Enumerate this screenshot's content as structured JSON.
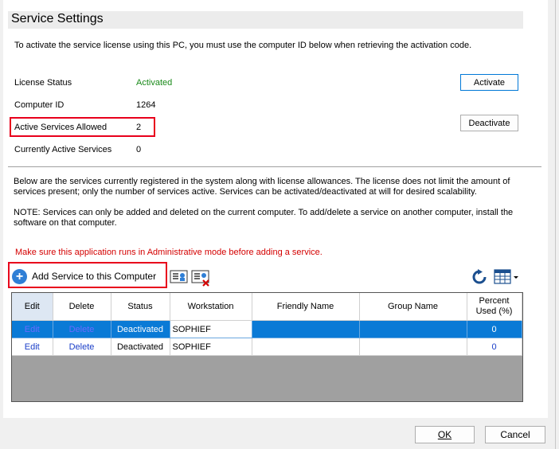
{
  "header": {
    "title": "Service Settings"
  },
  "intro": "To activate the service license using this PC, you must use the computer ID below when retrieving the activation code.",
  "license": {
    "status_label": "License Status",
    "status_value": "Activated",
    "computer_id_label": "Computer ID",
    "computer_id_value": "1264",
    "allowed_label": "Active Services Allowed",
    "allowed_value": "2",
    "active_label": "Currently Active Services",
    "active_value": "0"
  },
  "buttons": {
    "activate": "Activate",
    "deactivate": "Deactivate"
  },
  "info": {
    "para1": "Below are the services currently registered in the system along with license allowances. The license does not limit the amount of services present; only the number of services active. Services can be activated/deactivated at will for desired scalability.",
    "para2": "NOTE: Services can only be added and deleted on the current computer. To add/delete a service on another computer, install the software on that computer.",
    "warning": "Make sure this application runs in Administrative mode before adding a service."
  },
  "toolbar": {
    "add_service": "Add Service to this Computer"
  },
  "grid": {
    "columns": [
      "Edit",
      "Delete",
      "Status",
      "Workstation",
      "Friendly Name",
      "Group Name",
      "Percent Used (%)"
    ],
    "rows": [
      {
        "edit": "Edit",
        "delete": "Delete",
        "status": "Deactivated",
        "workstation": "SOPHIEF",
        "friendly_name": "",
        "group_name": "",
        "percent": "0"
      },
      {
        "edit": "Edit",
        "delete": "Delete",
        "status": "Deactivated",
        "workstation": "SOPHIEF",
        "friendly_name": "",
        "group_name": "",
        "percent": "0"
      }
    ]
  },
  "footer": {
    "ok": "OK",
    "cancel": "Cancel"
  },
  "colors": {
    "selection": "#0a7ad6",
    "status_active": "#1a8a1a",
    "warning": "#d40000",
    "highlight": "#e8001c"
  }
}
